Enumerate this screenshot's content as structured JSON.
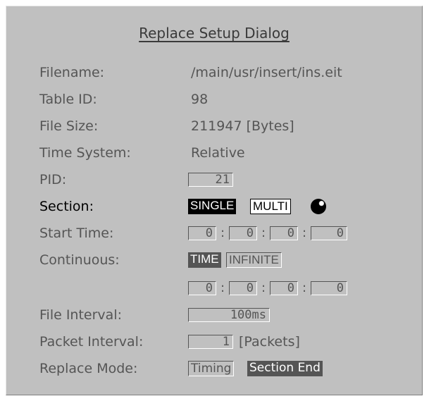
{
  "dialog": {
    "title": "Replace Setup Dialog"
  },
  "fields": {
    "filename": {
      "label": "Filename:",
      "value": "/main/usr/insert/ins.eit"
    },
    "table_id": {
      "label": "Table ID:",
      "value": "98"
    },
    "file_size": {
      "label": "File Size:",
      "value": "211947 [Bytes]"
    },
    "time_system": {
      "label": "Time System:",
      "value": "Relative"
    },
    "pid": {
      "label": "PID:",
      "value": "21"
    },
    "section": {
      "label": "Section:",
      "options": [
        "SINGLE",
        "MULTI"
      ],
      "selected": "SINGLE"
    },
    "start_time": {
      "label": "Start Time:",
      "values": [
        "0",
        "0",
        "0",
        "0"
      ],
      "separator": ":"
    },
    "continuous": {
      "label": "Continuous:",
      "options": [
        "TIME",
        "INFINITE"
      ],
      "selected": "TIME",
      "values": [
        "0",
        "0",
        "0",
        "0"
      ]
    },
    "file_interval": {
      "label": "File Interval:",
      "value": "100ms"
    },
    "packet_interval": {
      "label": "Packet Interval:",
      "value": "1",
      "unit": "[Packets]"
    },
    "replace_mode": {
      "label": "Replace Mode:",
      "options": [
        "Timing",
        "Section End"
      ],
      "selected": "Section End"
    }
  },
  "icons": {
    "section_indicator": "ball-icon"
  }
}
